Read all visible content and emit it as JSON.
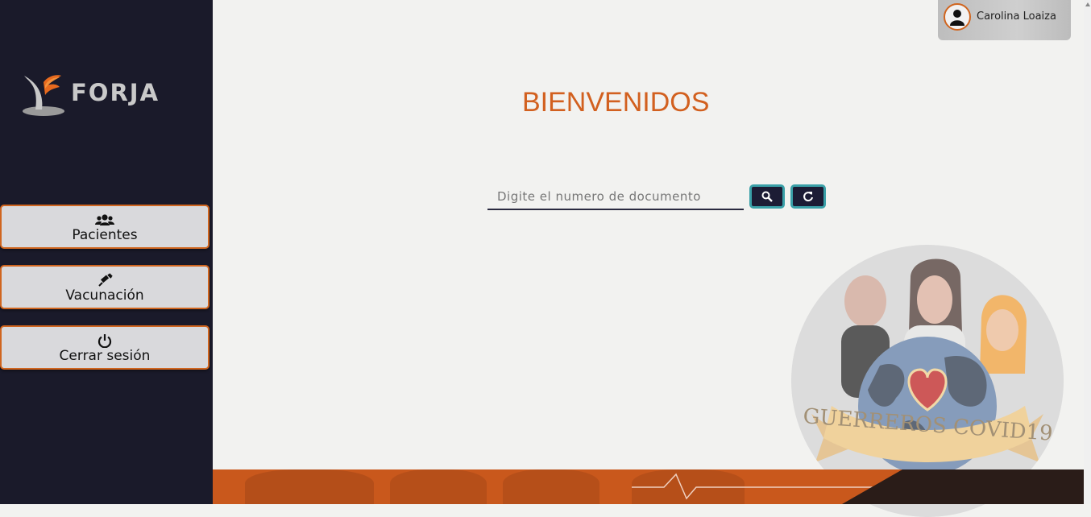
{
  "brand": {
    "name": "FORJA"
  },
  "sidebar": {
    "items": [
      {
        "label": "Pacientes",
        "icon": "users-icon"
      },
      {
        "label": "Vacunación",
        "icon": "syringe-icon"
      },
      {
        "label": "Cerrar sesión",
        "icon": "power-icon"
      }
    ]
  },
  "user": {
    "name": "Carolina Loaiza"
  },
  "main": {
    "title": "BIENVENIDOS",
    "search": {
      "placeholder": "Digite el numero de documento",
      "value": ""
    },
    "search_button_icon": "search-icon",
    "reset_button_icon": "refresh-icon"
  },
  "badge": {
    "text": "GUERREROS COVID19"
  },
  "colors": {
    "sidebar_bg": "#1a1a2a",
    "accent": "#d2601f",
    "button_bg": "#1c1c35",
    "button_border": "#3aa0a8"
  }
}
